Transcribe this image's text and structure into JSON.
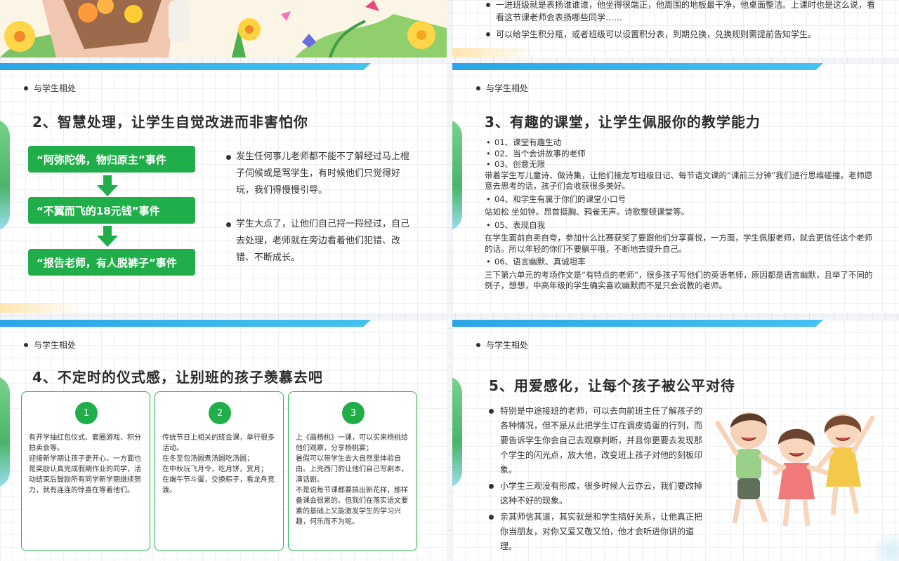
{
  "top_left": {
    "art": "flowers-illustration"
  },
  "top_right": {
    "bullets": [
      "一进班级就是表扬谁谁谁，他坐得很端正，他周围的地板最干净，他桌面整洁。上课时也是这么说，看看这节课老师会表扬哪些同学……",
      "可以给学生积分瓶，或者班级可以设置积分表，到期兑换，兑换规则需提前告知学生。"
    ]
  },
  "slide1": {
    "tag": "与学生相处",
    "title": "2、智慧处理，让学生自觉改进而非害怕你",
    "events": [
      "“阿弥陀佛，物归原主”事件",
      "“不翼而飞的18元钱”事件",
      "“报告老师，有人脱裤子”事件"
    ],
    "bullets": [
      "发生任何事儿老师都不能不了解经过马上棍子伺候或是骂学生，有时候他们只觉得好玩，我们得慢慢引导。",
      "学生大点了，让他们自己捋一捋经过，自己去处理，老师就在旁边看着他们犯错、改错、不断成长。"
    ]
  },
  "slide2": {
    "tag": "与学生相处",
    "title": "3、有趣的课堂，让学生佩服你的教学能力",
    "items": [
      {
        "li": "01、课堂有趣生动"
      },
      {
        "li": "02、当个会讲故事的老师"
      },
      {
        "li": "03、创意无限"
      },
      {
        "para": "带着学生写儿童诗、做诗集，让他们接龙写班级日记、每节语文课的“课前三分钟”我们进行思维碰撞。老师愿意去思考的话，孩子们会收获很多美好。"
      },
      {
        "li": "04、和学生有属于你们的课堂小口号"
      },
      {
        "para": "站如松 坐如钟。昂首挺胸、鸦雀无声。诗歌整顿课堂等。"
      },
      {
        "li": "05、表现自我"
      },
      {
        "para": "在学生面前自卖自夸，参加什么比赛获奖了要跟他们分享喜悦，一方面，学生佩服老师，就会更信任这个老师的话。所以年轻的你们不要躺平哦，不断地去提升自己。"
      },
      {
        "li": "06、语言幽默、真诚坦率"
      },
      {
        "para": "三下第六单元的考场作文是“有特点的老师”，很多孩子写他们的英语老师，原因都是语言幽默，且举了不同的例子，想想，中高年级的学生确实喜欢幽默而不是只会说教的老师。"
      }
    ]
  },
  "slide3": {
    "tag": "与学生相处",
    "title": "4、不定时的仪式感，让别班的孩子羡慕去吧",
    "cards": [
      {
        "num": "1",
        "text": "有开学抽红包仪式、套圈游戏、积分拍卖会等。\n迎接新学期让孩子更开心，一方面也是奖励认真完成假期作业的同学，活动结束后鼓励所有同学新学期继续努力，就有连连的惊喜在等着他们。"
      },
      {
        "num": "2",
        "text": "传统节日上相关的班会课，举行很多活动。\n在冬至包汤圆煮汤圆吃汤圆；\n在中秋玩飞月令，吃月饼，赏月；\n在端午节斗蛋，交换粽子，看龙舟竞渡。"
      },
      {
        "num": "3",
        "text": "上《画杨桃》一课，可以买来杨桃给他们观察，分享杨桃宴；\n暑假可以带学生去大自然里体验自由。上完西门豹让他们自己写剧本，演话剧。\n不是说每节课都要搞出新花样，那样备课会很累的。但我们在落实语文要素的基础上又能激发学生的学习兴趣，何乐而不为呢。"
      }
    ]
  },
  "slide4": {
    "tag": "与学生相处",
    "title": "5、用爱感化，让每个孩子被公平对待",
    "bullets": [
      "特别是中途接班的老师，可以去向前班主任了解孩子的各种情况，但不是从此把学生订在调皮捣蛋的行列，而要告诉学生你会自己去观察判断，并且你更要去发现那个学生的闪光点，放大他，改变班上孩子对他的刻板印象。",
      "小学生三观没有形成，很多时候人云亦云，我们要改掉这种不好的现象。",
      "亲其师信其道，其实就是和学生搞好关系，让他真正把你当朋友，对你又爱又敬又怕，他才会听进你讲的道理。"
    ],
    "art": "happy-children-illustration"
  },
  "colors": {
    "green": "#1fae49",
    "blue": "#2aa6e8",
    "text": "#333333"
  }
}
